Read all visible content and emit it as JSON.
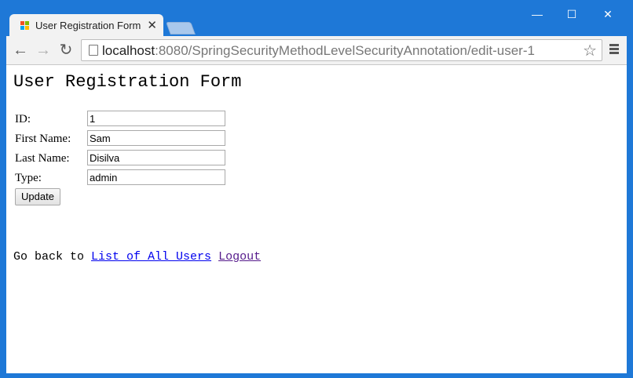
{
  "browser": {
    "tab_title": "User Registration Form",
    "tab_close": "✕",
    "url_host": "localhost",
    "url_rest": ":8080/SpringSecurityMethodLevelSecurityAnnotation/edit-user-1"
  },
  "window_controls": {
    "minimize": "—",
    "maximize": "☐",
    "close": "✕"
  },
  "icons": {
    "back": "←",
    "forward": "→",
    "reload": "↻",
    "star": "☆"
  },
  "page": {
    "title": "User Registration Form",
    "form": {
      "id_label": "ID:",
      "id_value": "1",
      "first_label": "First Name:",
      "first_value": "Sam",
      "last_label": "Last Name:",
      "last_value": "Disilva",
      "type_label": "Type:",
      "type_value": "admin",
      "submit_label": "Update"
    },
    "footer": {
      "prefix": "Go back to",
      "list_link": "List of All Users",
      "logout_link": "Logout"
    }
  },
  "colors": {
    "titlebar": "#1e78d7",
    "link": "#0000ee",
    "visited_link": "#551a8b"
  }
}
